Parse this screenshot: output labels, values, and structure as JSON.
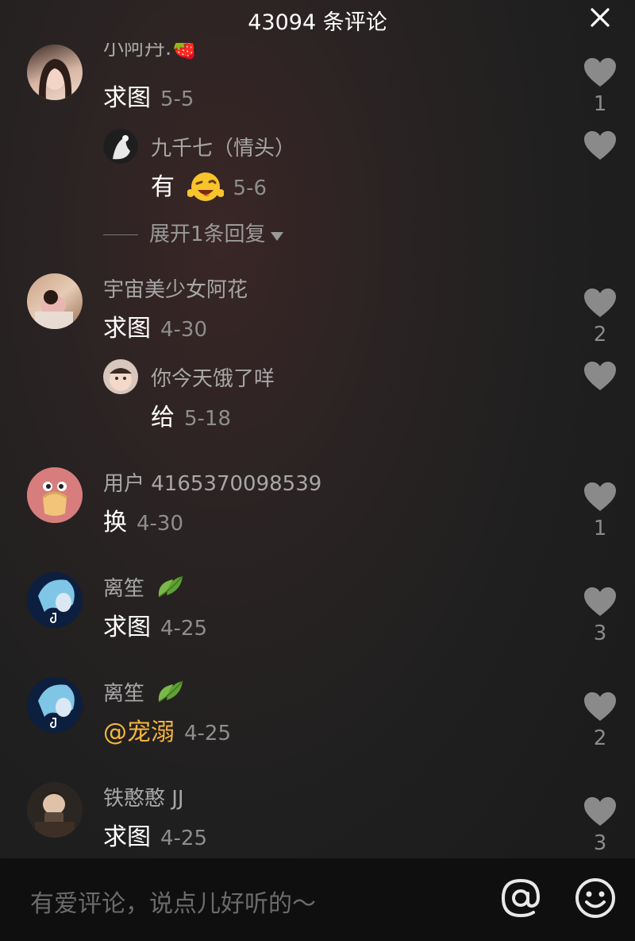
{
  "header": {
    "title": "43094 条评论"
  },
  "comments": [
    {
      "name": "小阿丹.🍓",
      "text": "求图",
      "date": "5-5",
      "likes": "1"
    },
    {
      "name": "九千七（情头）",
      "text": "有",
      "date": "5-6",
      "likes": ""
    },
    {
      "expand": "展开1条回复"
    },
    {
      "name": "宇宙美少女阿花",
      "text": "求图",
      "date": "4-30",
      "likes": "2"
    },
    {
      "name": "你今天饿了咩",
      "text": "给",
      "date": "5-18",
      "likes": ""
    },
    {
      "name": "用户 4165370098539",
      "text": "换",
      "date": "4-30",
      "likes": "1"
    },
    {
      "name": "离笙",
      "text": "求图",
      "date": "4-25",
      "likes": "3"
    },
    {
      "name": "离笙",
      "text": "@宠溺",
      "date": "4-25",
      "likes": "2"
    },
    {
      "name": "铁憨憨 JJ",
      "text": "求图",
      "date": "4-25",
      "likes": "3"
    }
  ],
  "input": {
    "placeholder": "有爱评论，说点儿好听的～"
  },
  "colors": {
    "mention": "#f6b63f",
    "name": "#a7a7a7",
    "date": "#8e8e8e",
    "bar": "#0f0f0f"
  },
  "icons": [
    "close-icon",
    "heart-icon",
    "at-icon",
    "emoji-icon",
    "leaf-icon",
    "wink-emoji"
  ]
}
